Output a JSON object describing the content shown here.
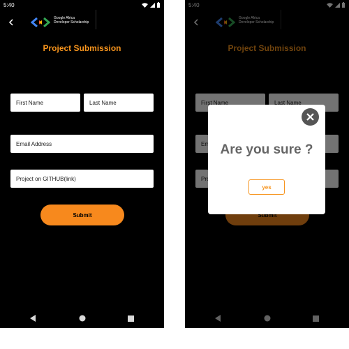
{
  "status_bar": {
    "time": "5:40"
  },
  "brand": {
    "line1": "Google Africa",
    "line2": "Developer Scholarship"
  },
  "page": {
    "title": "Project Submission"
  },
  "form": {
    "first_name_placeholder": "First Name",
    "last_name_placeholder": "Last Name",
    "email_placeholder": "Email Address",
    "github_placeholder": "Project on GITHUB(link)",
    "submit_label": "Submit"
  },
  "dialog": {
    "message": "Are you sure ?",
    "yes_label": "yes"
  },
  "colors": {
    "accent": "#f7941d",
    "background": "#000000",
    "dialog_text": "#666666"
  },
  "icons": {
    "back": "back-arrow-icon",
    "close": "close-icon",
    "wifi": "wifi-icon",
    "signal": "signal-icon",
    "battery": "battery-icon",
    "nav_back": "nav-back-icon",
    "nav_home": "nav-home-icon",
    "nav_recents": "nav-recents-icon"
  }
}
